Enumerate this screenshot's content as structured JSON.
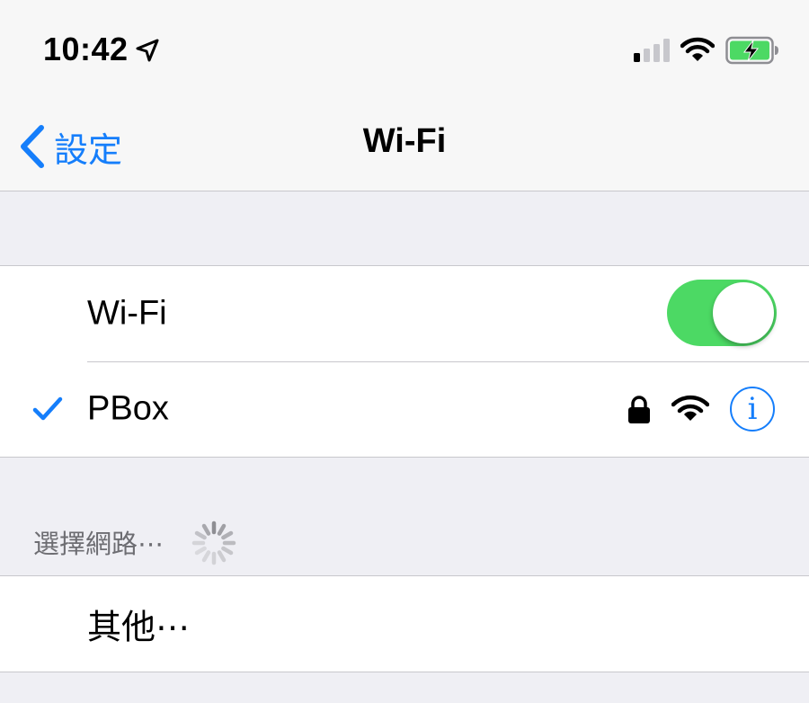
{
  "status_bar": {
    "time": "10:42",
    "icons": [
      "location-arrow-icon",
      "cellular-signal-icon",
      "wifi-icon",
      "battery-charging-icon"
    ],
    "battery_color": "#4cd964"
  },
  "nav": {
    "back_label": "設定",
    "title": "Wi-Fi"
  },
  "wifi_toggle": {
    "label": "Wi-Fi",
    "on": true,
    "color": "#4cd964"
  },
  "connected_network": {
    "name": "PBox",
    "selected": true,
    "secured": true,
    "icons": [
      "checkmark-icon",
      "lock-icon",
      "wifi-signal-icon",
      "info-icon"
    ],
    "info_glyph": "i"
  },
  "networks_section": {
    "header": "選擇網路⋯",
    "loading": true
  },
  "other_row": {
    "label": "其他⋯"
  },
  "colors": {
    "accent": "#157efb",
    "background": "#efeff4",
    "separator": "#c8c7cc"
  }
}
